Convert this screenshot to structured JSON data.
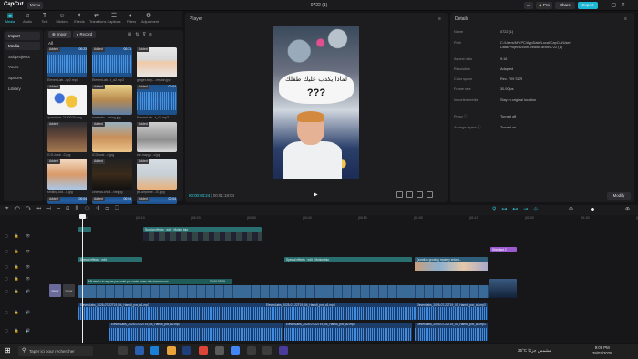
{
  "app": {
    "logo": "CapCut",
    "menu_label": "Menu",
    "project_title": "0722 (1)"
  },
  "titlebar_buttons": {
    "pro": "Pro",
    "share": "Share",
    "export": "Export"
  },
  "toolbar": [
    {
      "label": "Media",
      "icon": "media-icon",
      "active": true
    },
    {
      "label": "Audio",
      "icon": "audio-icon"
    },
    {
      "label": "Text",
      "icon": "text-icon"
    },
    {
      "label": "Stickers",
      "icon": "stickers-icon"
    },
    {
      "label": "Effects",
      "icon": "effects-icon"
    },
    {
      "label": "Transitions",
      "icon": "transitions-icon"
    },
    {
      "label": "Captions",
      "icon": "captions-icon"
    },
    {
      "label": "Filters",
      "icon": "filters-icon"
    },
    {
      "label": "Adjustment",
      "icon": "adjustment-icon"
    }
  ],
  "sidebar": [
    {
      "label": "Import",
      "active": false
    },
    {
      "label": "Media",
      "active": true
    },
    {
      "label": "Subprojects"
    },
    {
      "label": "Yours"
    },
    {
      "label": "Spaces"
    },
    {
      "label": "Library"
    }
  ],
  "media": {
    "import_label": "Import",
    "record_label": "Record",
    "all_label": "All",
    "added_label": "Added",
    "items": [
      {
        "name": "ElevenLab...dy2.mp3",
        "dur": "00:23",
        "kind": "audio"
      },
      {
        "name": "ElevenLab...t_a2.mp3",
        "dur": "00:31",
        "kind": "audio"
      },
      {
        "name": "ginger-boy-...ession.jpg",
        "dur": "",
        "kind": "img1"
      },
      {
        "name": "questions-2190029.png",
        "dur": "",
        "kind": "img2"
      },
      {
        "name": "romantic-...ming.jpg",
        "dur": "",
        "kind": "img3"
      },
      {
        "name": "ElevenLab...t_a1.mp3",
        "dur": "00:04",
        "kind": "audio"
      },
      {
        "name": "ICG-bodr...0.jpg",
        "dur": "",
        "kind": "img4"
      },
      {
        "name": "ICGbodr...0.jpg",
        "dur": "",
        "kind": "img5"
      },
      {
        "name": "ele-happy...d.jpg",
        "dur": "",
        "kind": "img6"
      },
      {
        "name": "smiling-kid...d.jpg",
        "dur": "",
        "kind": "img7"
      },
      {
        "name": "cinema-child...vie.jpg",
        "dur": "",
        "kind": "img8"
      },
      {
        "name": "jet-airplane...07.jpg",
        "dur": "",
        "kind": "img9"
      },
      {
        "name": "",
        "dur": "00:04",
        "kind": "audio"
      },
      {
        "name": "",
        "dur": "00:04",
        "kind": "audio"
      },
      {
        "name": "",
        "dur": "00:04",
        "kind": "audio"
      }
    ]
  },
  "player": {
    "title": "Player",
    "caption_ar": "لماذا يكذب عليك طفلك",
    "caption_q": "???",
    "time_current": "00:00:03:24",
    "time_total": "00:01:18:04"
  },
  "details": {
    "title": "Details",
    "rows": [
      {
        "label": "Name",
        "value": "0722 (1)"
      },
      {
        "label": "Path",
        "value": "C:/Users/MY PC/AppData/Local/CapCut/User Data/Projects/com.lveditor.draft/0722 (1)"
      },
      {
        "label": "Aspect ratio",
        "value": "9:16"
      },
      {
        "label": "Resolution",
        "value": "Adapted"
      },
      {
        "label": "Color space",
        "value": "Rec. 709 SDR"
      },
      {
        "label": "Frame rate",
        "value": "30.00fps"
      },
      {
        "label": "Imported media",
        "value": "Stay in original location"
      },
      {
        "label": "Proxy ⓘ",
        "value": "Turned off"
      },
      {
        "label": "Arrange layers ⓘ",
        "value": "Turned on"
      }
    ],
    "modify_label": "Modify"
  },
  "timeline": {
    "ruler": [
      "00:00",
      "|00:10",
      "|00:20",
      "|00:30",
      "|00:40",
      "|00:50",
      "|01:00",
      "|01:10",
      "|01:20",
      "|01:30",
      "|01:40"
    ],
    "fx_label": "Special effects · edit",
    "fx_label2": "Motion blur",
    "sticker_label": "Stick fact 2",
    "caption_clip": "Mit rien lu tu as pas pas saisi par contre avec cité dossion son",
    "caption_time": "00:00:03:09",
    "video_track_labels": [
      "Cover",
      "Cover"
    ],
    "long_text_clip": "Question growing mystery enfant...",
    "audio_clips": [
      "ElevenLabs_2025-07-22T19_04_Hamdi_pvc_a1.mp3",
      "ElevenLabs_2025-07-22T19_04_Hamdi_pvc_a2.mp3",
      "ElevenLabs_2025-07-22T19_03_Hamdi_pvc_a3.mp3",
      "ElevenLabs_2025-07-22T19_03_Hamdi_pvc_a4.mp3"
    ]
  },
  "taskbar": {
    "search_placeholder": "Taper ici pour rechercher",
    "weather": "25°C  مشمس جزئيًا",
    "time": "9:09 PM",
    "date": "29/07/2025"
  }
}
